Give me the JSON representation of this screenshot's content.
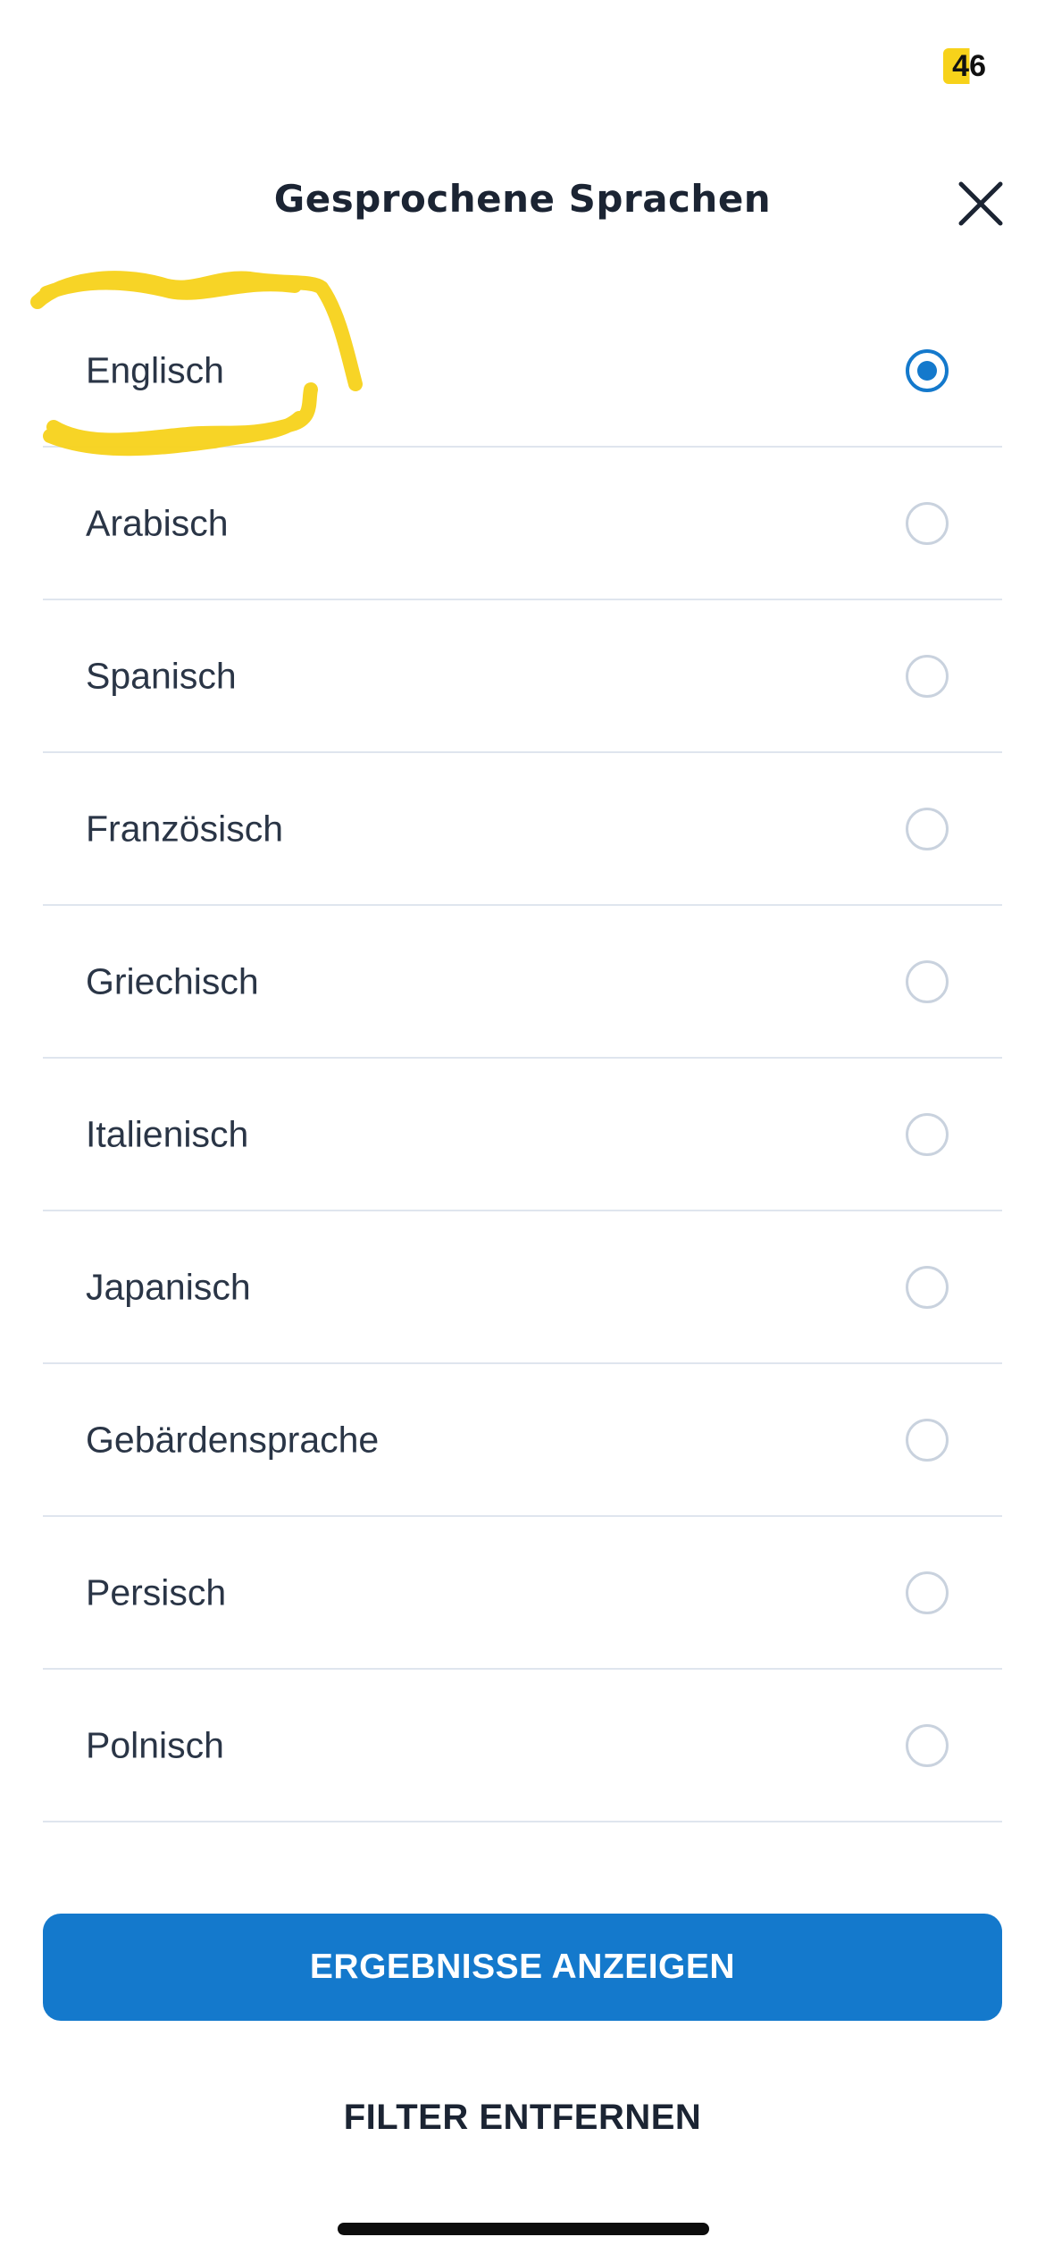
{
  "status_bar": {
    "badge": "46"
  },
  "header": {
    "title": "Gesprochene Sprachen",
    "close_icon": "close-icon"
  },
  "languages": [
    {
      "label": "Englisch",
      "selected": true
    },
    {
      "label": "Arabisch",
      "selected": false
    },
    {
      "label": "Spanisch",
      "selected": false
    },
    {
      "label": "Französisch",
      "selected": false
    },
    {
      "label": "Griechisch",
      "selected": false
    },
    {
      "label": "Italienisch",
      "selected": false
    },
    {
      "label": "Japanisch",
      "selected": false
    },
    {
      "label": "Gebärdensprache",
      "selected": false
    },
    {
      "label": "Persisch",
      "selected": false
    },
    {
      "label": "Polnisch",
      "selected": false
    }
  ],
  "actions": {
    "show_results": "ERGEBNISSE ANZEIGEN",
    "remove_filter": "FILTER ENTFERNEN"
  },
  "colors": {
    "accent": "#1479cc",
    "divider": "#dfe5ee",
    "highlight": "#f7d21a"
  }
}
